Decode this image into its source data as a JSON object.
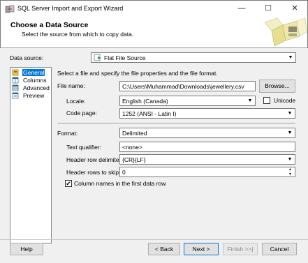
{
  "window": {
    "title": "SQL Server Import and Export Wizard",
    "minimize": "—",
    "maximize": "☐",
    "close": "✕"
  },
  "header": {
    "title": "Choose a Data Source",
    "subtitle": "Select the source from which to copy data."
  },
  "data_source": {
    "label": "Data source:",
    "value": "Flat File Source"
  },
  "nav": {
    "items": [
      {
        "label": "General",
        "icon": "general-icon",
        "selected": true
      },
      {
        "label": "Columns",
        "icon": "columns-icon"
      },
      {
        "label": "Advanced",
        "icon": "advanced-icon"
      },
      {
        "label": "Preview",
        "icon": "preview-icon"
      }
    ]
  },
  "form": {
    "intro": "Select a file and specify the file properties and the file format.",
    "file_name_label": "File name:",
    "file_name_value": "C:\\Users\\Muhammad\\Downloads\\jewellery.csv",
    "browse_label": "Browse...",
    "locale_label": "Locale:",
    "locale_value": "English (Canada)",
    "unicode_label": "Unicode",
    "unicode_checked": false,
    "code_page_label": "Code page:",
    "code_page_value": "1252  (ANSI - Latin I)",
    "format_label": "Format:",
    "format_value": "Delimited",
    "text_qualifier_label": "Text qualifier:",
    "text_qualifier_value": "<none>",
    "header_row_delim_label": "Header row delimiter:",
    "header_row_delim_value": "{CR}{LF}",
    "header_rows_skip_label": "Header rows to skip:",
    "header_rows_skip_value": "0",
    "column_names_label": "Column names in the first data row",
    "column_names_checked": true,
    "checkmark": "✔"
  },
  "buttons": {
    "help": "Help",
    "back": "< Back",
    "next": "Next >",
    "finish": "Finish >>|",
    "cancel": "Cancel"
  },
  "colors": {
    "selection": "#0078d7",
    "window_bg": "#f0f0f0"
  }
}
